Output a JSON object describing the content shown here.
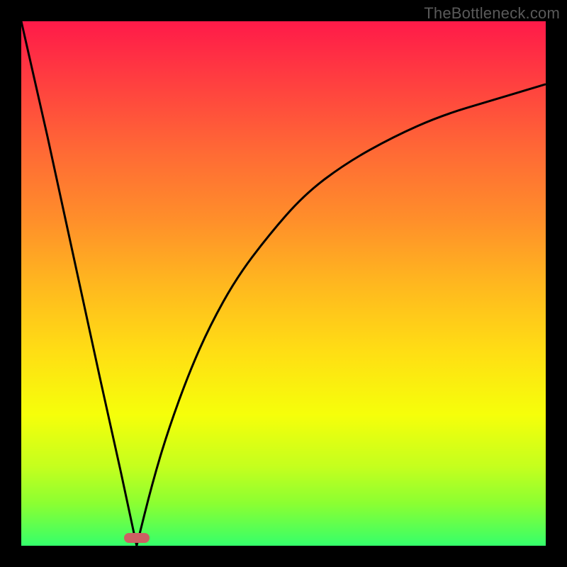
{
  "watermark": "TheBottleneck.com",
  "colors": {
    "frame": "#000000",
    "curve": "#000000",
    "marker": "#cd6063",
    "gradient_top": "#ff1a49",
    "gradient_bottom": "#35ff6b"
  },
  "chart_data": {
    "type": "line",
    "title": "",
    "xlabel": "",
    "ylabel": "",
    "xlim": [
      0,
      100
    ],
    "ylim": [
      0,
      100
    ],
    "series": [
      {
        "name": "left-branch",
        "x": [
          0,
          5,
          10,
          15,
          19,
          22
        ],
        "values": [
          100,
          78,
          55,
          32,
          14,
          0
        ]
      },
      {
        "name": "right-branch",
        "x": [
          22,
          25,
          28,
          32,
          36,
          41,
          47,
          54,
          62,
          71,
          80,
          90,
          100
        ],
        "values": [
          0,
          12,
          22,
          33,
          42,
          51,
          59,
          67,
          73,
          78,
          82,
          85,
          88
        ]
      }
    ],
    "marker": {
      "x": 22,
      "y": 1.5
    },
    "notes": "Axes have no visible tick labels; values are read off as fraction of plot area (0–100)."
  }
}
